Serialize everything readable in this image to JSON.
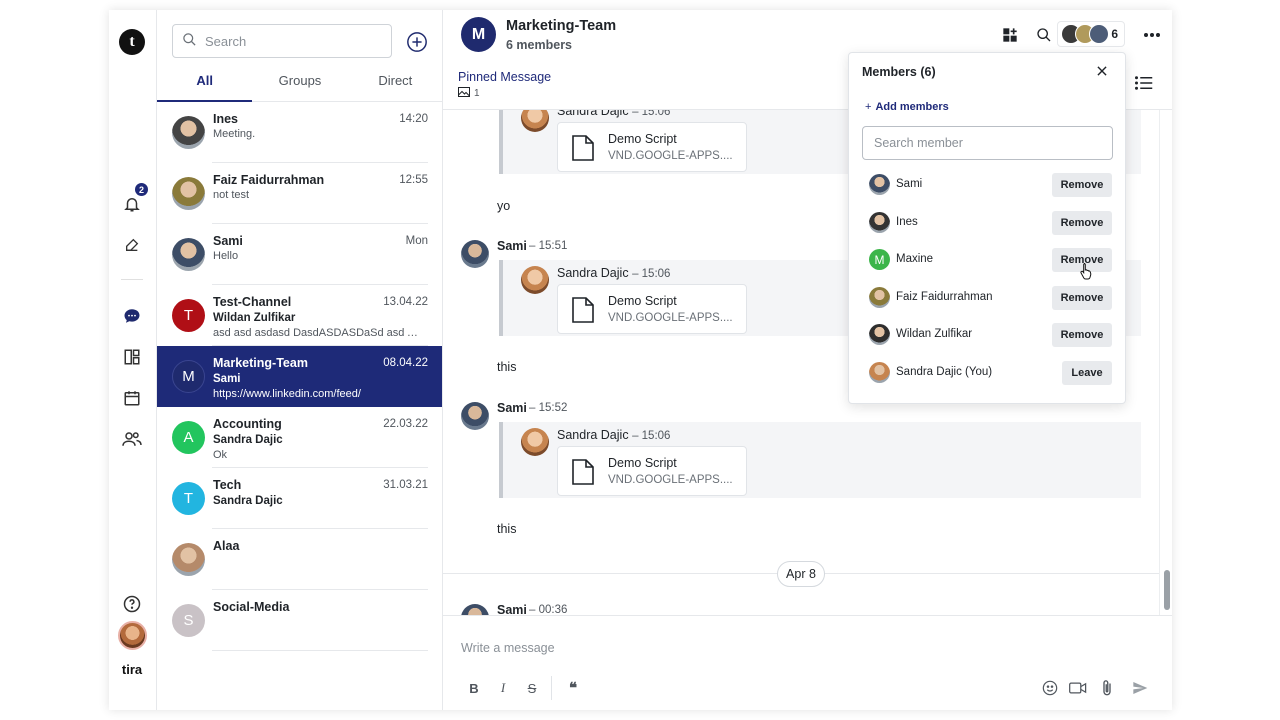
{
  "rail": {
    "logo_letter": "t",
    "notification_badge": "2",
    "user_name": "tira"
  },
  "list": {
    "search_placeholder": "Search",
    "tabs": [
      {
        "label": "All",
        "active": true
      },
      {
        "label": "Groups",
        "active": false
      },
      {
        "label": "Direct",
        "active": false
      }
    ],
    "conversations": [
      {
        "name": "Ines",
        "time": "14:20",
        "line2": "Meeting.",
        "line2_light": true,
        "line3": "",
        "avatar": "photo",
        "initial": "",
        "color": "#444"
      },
      {
        "name": "Faiz Faidurrahman",
        "time": "12:55",
        "line2": "not test",
        "line2_light": true,
        "line3": "",
        "avatar": "photo",
        "initial": "",
        "color": "#8a7a3a"
      },
      {
        "name": "Sami",
        "time": "Mon",
        "line2": "Hello",
        "line2_light": true,
        "line3": "",
        "avatar": "photo",
        "initial": "",
        "color": "#3d4d66"
      },
      {
        "name": "Test-Channel",
        "time": "13.04.22",
        "line2": "Wildan Zulfikar",
        "line2_light": false,
        "line3": "asd asd asdasd DasdASDASDaSd asd ASDASD",
        "avatar": "letter",
        "initial": "T",
        "color": "#b00f16"
      },
      {
        "name": "Marketing-Team",
        "time": "08.04.22",
        "line2": "Sami",
        "line2_light": false,
        "line3": "https://www.linkedin.com/feed/",
        "avatar": "letter",
        "initial": "M",
        "color": "#1f2a6e"
      },
      {
        "name": "Accounting",
        "time": "22.03.22",
        "line2": "Sandra Dajic",
        "line2_light": false,
        "line3": "Ok",
        "avatar": "letter",
        "initial": "A",
        "color": "#22c55e"
      },
      {
        "name": "Tech",
        "time": "31.03.21",
        "line2": "Sandra Dajic",
        "line2_light": false,
        "line3": "",
        "avatar": "letter",
        "initial": "T",
        "color": "#22b5e0"
      },
      {
        "name": "Alaa",
        "time": "",
        "line2": "",
        "line2_light": false,
        "line3": "",
        "avatar": "photo",
        "initial": "",
        "color": "#b58a6a"
      },
      {
        "name": "Social-Media",
        "time": "",
        "line2": "",
        "line2_light": false,
        "line3": "",
        "avatar": "letter",
        "initial": "S",
        "color": "#c9c2c6"
      }
    ]
  },
  "chat": {
    "avatar_letter": "M",
    "title": "Marketing-Team",
    "subtitle": "6 members",
    "member_count": "6",
    "pinned_title": "Pinned Message",
    "pinned_count": "1",
    "quoted_sender": "Sandra Dajic",
    "quoted_time": "– 15:06",
    "file_name": "Demo Script",
    "file_type": "VND.GOOGLE-APPS....",
    "messages": [
      {
        "sender": "",
        "time": "",
        "text": "yo"
      },
      {
        "sender": "Sami",
        "time": "– 15:51",
        "text": "this"
      },
      {
        "sender": "Sami",
        "time": "– 15:52",
        "text": "this"
      },
      {
        "sender": "Sami",
        "time": "– 00:36",
        "text": ""
      }
    ],
    "date_separator": "Apr 8",
    "composer_placeholder": "Write a message",
    "format": {
      "bold": "B",
      "italic": "I",
      "strike": "S",
      "quote": "❝"
    }
  },
  "members_panel": {
    "title": "Members (6)",
    "add_label": "Add members",
    "search_placeholder": "Search member",
    "members": [
      {
        "name": "Sami",
        "action": "Remove",
        "avatar": "photo",
        "color": "#3d4d66",
        "initial": ""
      },
      {
        "name": "Ines",
        "action": "Remove",
        "avatar": "photo",
        "color": "#333",
        "initial": ""
      },
      {
        "name": "Maxine",
        "action": "Remove",
        "avatar": "letter",
        "color": "#3cb54a",
        "initial": "M"
      },
      {
        "name": "Faiz Faidurrahman",
        "action": "Remove",
        "avatar": "photo",
        "color": "#8a7a3a",
        "initial": ""
      },
      {
        "name": "Wildan Zulfikar",
        "action": "Remove",
        "avatar": "photo",
        "color": "#2e2e2e",
        "initial": ""
      },
      {
        "name": "Sandra Dajic (You)",
        "action": "Leave",
        "avatar": "photo",
        "color": "#c6844f",
        "initial": ""
      }
    ]
  }
}
